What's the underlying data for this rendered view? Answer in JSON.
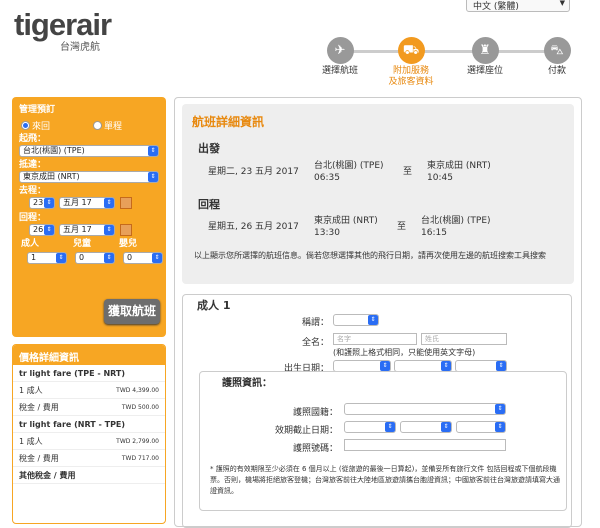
{
  "brand": {
    "name": "tigerair",
    "sub": "台灣虎航"
  },
  "language": {
    "selected": "中文 (繁體)"
  },
  "steps": [
    {
      "label": "選擇航班",
      "icon": "plane-icon",
      "active": false
    },
    {
      "label": "附加服務\n及旅客資料",
      "icon": "luggage-icon",
      "active": true
    },
    {
      "label": "選擇座位",
      "icon": "seat-icon",
      "active": false
    },
    {
      "label": "付款",
      "icon": "cart-icon",
      "active": false
    }
  ],
  "booking": {
    "title": "管理預訂",
    "trip_round": "來回",
    "trip_one": "單程",
    "from_label": "起飛：",
    "from": "台北(桃園) (TPE)",
    "to_label": "抵達：",
    "to": "東京成田 (NRT)",
    "depart_label": "去程：",
    "depart_day": "23",
    "depart_month": "五月 17",
    "return_label": "回程：",
    "return_day": "26",
    "return_month": "五月 17",
    "adult_label": "成人",
    "child_label": "兒童",
    "infant_label": "嬰兒",
    "adult": "1",
    "child": "0",
    "infant": "0",
    "search": "獲取航班"
  },
  "price": {
    "title": "價格詳細資訊",
    "rows": [
      {
        "label": "tr light fare (TPE - NRT)",
        "value": "",
        "bold": true
      },
      {
        "label": "1 成人",
        "value": "TWD 4,399.00",
        "bold": false
      },
      {
        "label": "稅金 / 費用",
        "value": "TWD 500.00",
        "bold": false
      },
      {
        "label": "tr light fare (NRT - TPE)",
        "value": "",
        "bold": true
      },
      {
        "label": "1 成人",
        "value": "TWD 2,799.00",
        "bold": false
      },
      {
        "label": "稅金 / 費用",
        "value": "TWD 717.00",
        "bold": false
      },
      {
        "label": "其他稅金 / 費用",
        "value": "",
        "bold": true
      }
    ]
  },
  "flight": {
    "title": "航班詳細資訊",
    "out_title": "出發",
    "out_date": "星期二, 23 五月 2017",
    "out_from": "台北(桃園) (TPE)",
    "out_dep": "06:35",
    "out_to": "東京成田 (NRT)",
    "out_arr": "10:45",
    "ret_title": "回程",
    "ret_date": "星期五, 26 五月 2017",
    "ret_from": "東京成田 (NRT)",
    "ret_dep": "13:30",
    "ret_to": "台北(桃園) (TPE)",
    "ret_arr": "16:15",
    "to_word": "至",
    "note": "以上顯示您所選擇的航班信息。倘若您想選擇其他的飛行日期，請再次使用左邊的航班搜索工具搜索"
  },
  "passenger": {
    "title": "成人 1",
    "salutation": "稱謂：",
    "fullname": "全名：",
    "first_ph": "名字",
    "last_ph": "姓氏",
    "name_hint": "(和護照上格式相同，只能使用英文字母)",
    "dob": "出生日期：",
    "passport_title": "護照資訊：",
    "nationality": "護照國籍：",
    "expiry": "效期截止日期：",
    "number": "護照號碼：",
    "passport_note": "* 護照的有效期限至少必須在 6 個月以上 (從旅遊的最後一日算起)，並備妥所有旅行文件 包括回程或下個航段機票。否則，機場將拒絕旅客登機；台灣旅客前往大陸地區旅遊請攜台胞證資訊；中國旅客前往台灣旅遊請填寫大通證資訊。"
  }
}
